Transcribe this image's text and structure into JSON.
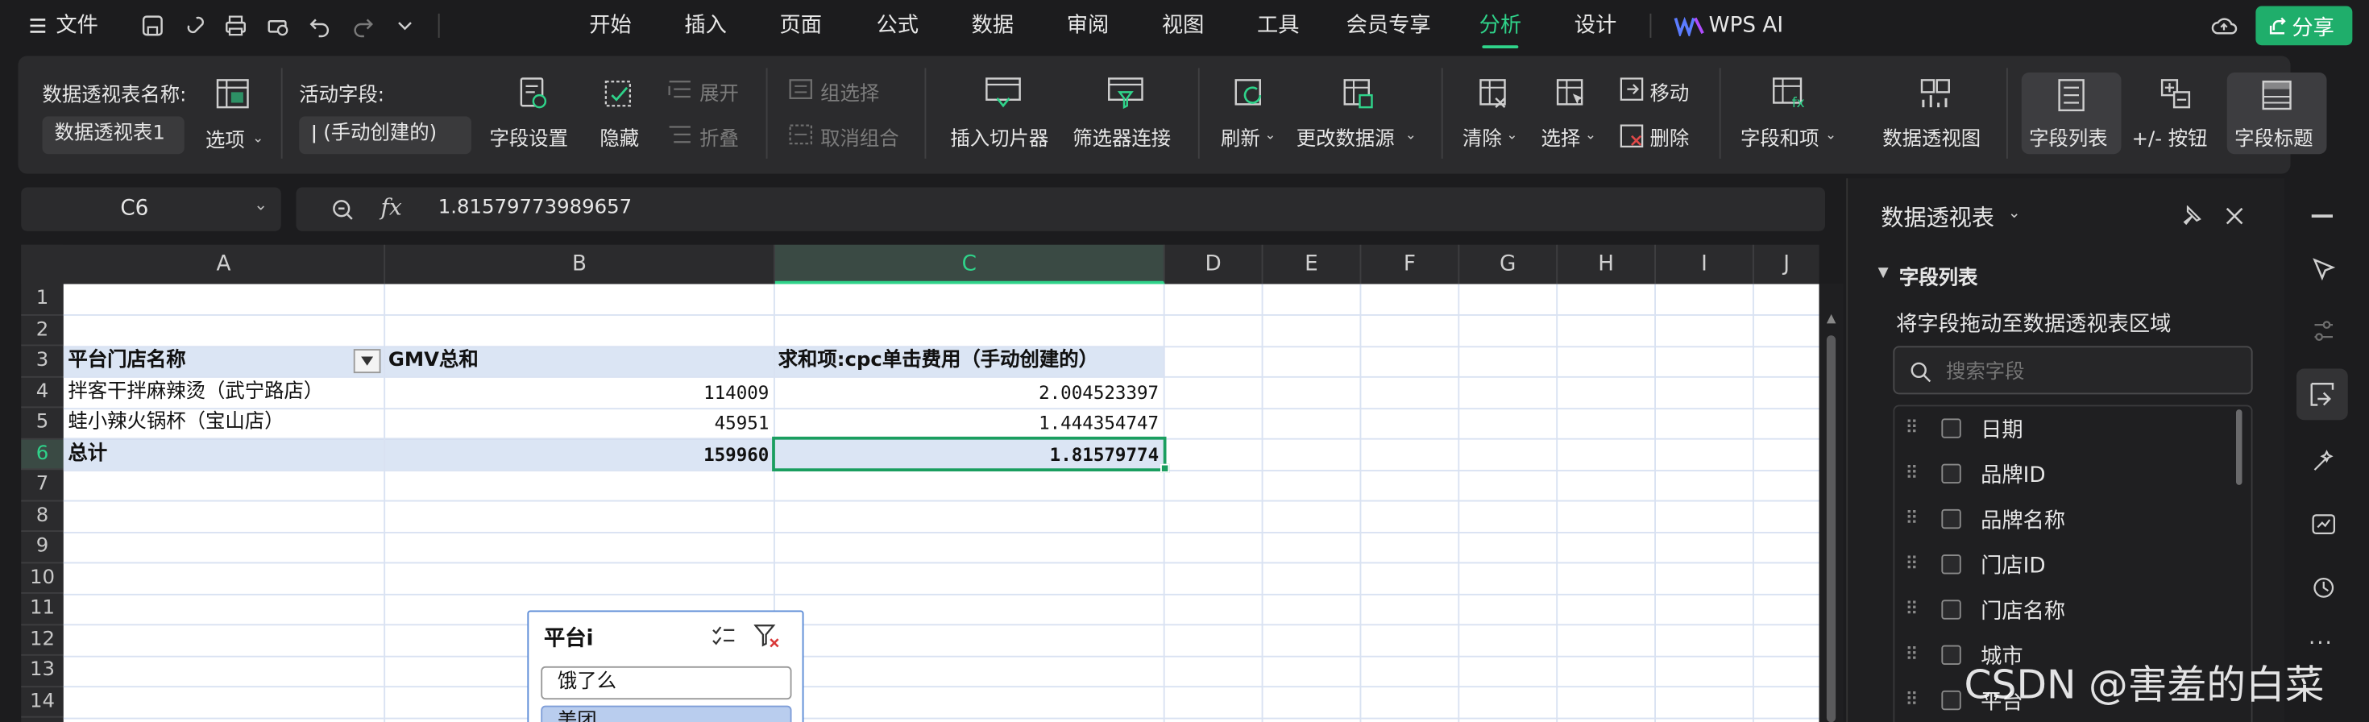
{
  "titlebar": {
    "file_menu": "文件",
    "menus": [
      "开始",
      "插入",
      "页面",
      "公式",
      "数据",
      "审阅",
      "视图",
      "工具",
      "会员专享",
      "分析",
      "设计"
    ],
    "active_menu": "分析",
    "ai_label": "WPS AI",
    "share_label": "分享"
  },
  "ribbon": {
    "pivot_name_label": "数据透视表名称:",
    "pivot_name_value": "数据透视表1",
    "options_label": "选项",
    "active_field_label": "活动字段:",
    "active_field_value": "(手动创建的)",
    "field_settings_label": "字段设置",
    "hide_label": "隐藏",
    "expand_label": "展开",
    "collapse_label": "折叠",
    "group_select_label": "组选择",
    "ungroup_label": "取消组合",
    "insert_slicer_label": "插入切片器",
    "filter_connection_label": "筛选器连接",
    "refresh_label": "刷新",
    "change_source_label": "更改数据源",
    "clear_label": "清除",
    "select_label": "选择",
    "move_label": "移动",
    "delete_label": "删除",
    "fields_items_label": "字段和项",
    "pivot_chart_label": "数据透视图",
    "field_list_label": "字段列表",
    "plus_minus_label": "+/- 按钮",
    "field_header_label": "字段标题"
  },
  "formula_bar": {
    "cell_ref": "C6",
    "fx_label": "fx",
    "formula": "1.81579773989657"
  },
  "sheet": {
    "columns": [
      "A",
      "B",
      "C",
      "D",
      "E",
      "F",
      "G",
      "H",
      "I",
      "J"
    ],
    "selected_column": "C",
    "rows": [
      "1",
      "2",
      "3",
      "4",
      "5",
      "6",
      "7",
      "8",
      "9",
      "10",
      "11",
      "12",
      "13",
      "14"
    ],
    "selected_row": "6",
    "header": {
      "a": "平台门店名称",
      "b": "GMV总和",
      "c": "求和项:cpc单击费用（手动创建的）"
    },
    "data_rows": [
      {
        "a": "拌客干拌麻辣烫（武宁路店）",
        "b": "114009",
        "c": "2.004523397"
      },
      {
        "a": "蛙小辣火锅杯（宝山店）",
        "b": "45951",
        "c": "1.444354747"
      }
    ],
    "total_row": {
      "a": "总计",
      "b": "159960",
      "c": "1.81579774"
    }
  },
  "slicer": {
    "title": "平台i",
    "items": [
      "饿了么",
      "美团"
    ]
  },
  "panel": {
    "title": "数据透视表",
    "section_title": "字段列表",
    "hint": "将字段拖动至数据透视表区域",
    "search_placeholder": "搜索字段",
    "fields": [
      "日期",
      "品牌ID",
      "品牌名称",
      "门店ID",
      "门店名称",
      "城市",
      "平台"
    ]
  },
  "watermark": "CSDN @害羞的白菜",
  "colors": {
    "accent": "#2fd38a",
    "header_fill": "#dbe5f4",
    "share_button": "#1fae6b"
  }
}
